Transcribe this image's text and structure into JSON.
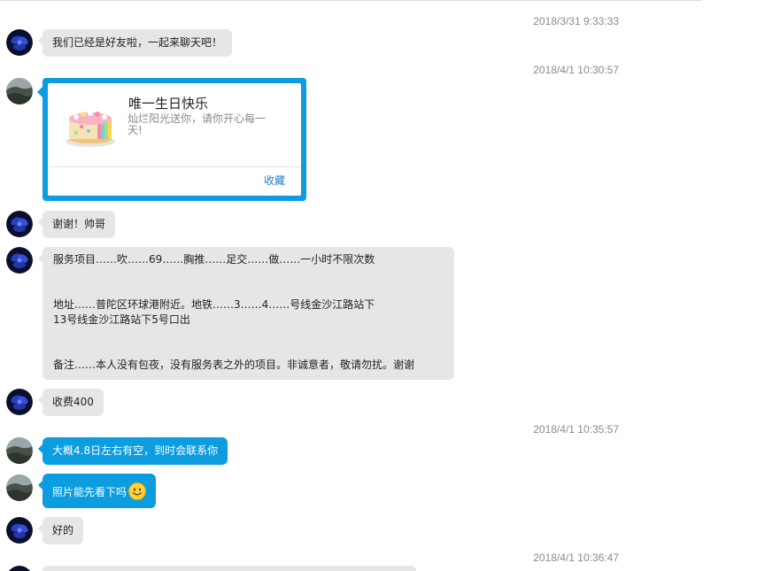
{
  "messages": {
    "ts1": "2018/3/31 9:33:33",
    "m1": "我们已经是好友啦，一起来聊天吧！",
    "ts2": "2018/4/1 10:30:57",
    "card": {
      "title": "唯一生日快乐",
      "desc": "灿烂阳光送你，请你开心每一天!",
      "action": "收藏"
    },
    "m2": "谢谢！帅哥",
    "m3": {
      "line1": "服务项目……吹……69……胸推……足交……做……一小时不限次数",
      "line2": "地址……普陀区环球港附近。地铁……3……4……号线金沙江路站下",
      "line3": "13号线金沙江路站下5号口出",
      "line4": "备注……本人没有包夜，没有服务表之外的项目。非诚意者，敬请勿扰。谢谢"
    },
    "m4": "收费400",
    "ts3": "2018/4/1 10:35:57",
    "m5": "大概4.8日左右有空，到时会联系你",
    "m6": "照片能先看下吗",
    "m7": "好的",
    "ts4": "2018/4/1 10:36:47"
  },
  "icons": {
    "contact_avatar": "blue-flower-avatar",
    "self_avatar": "landscape-avatar",
    "card_image": "birthday-cake",
    "emoji": "smile-emoji"
  },
  "colors": {
    "outgoing_bubble": "#0b9de0",
    "incoming_bubble": "#e6e6e6",
    "timestamp": "#8a8a8a",
    "link": "#1a7fc0"
  }
}
